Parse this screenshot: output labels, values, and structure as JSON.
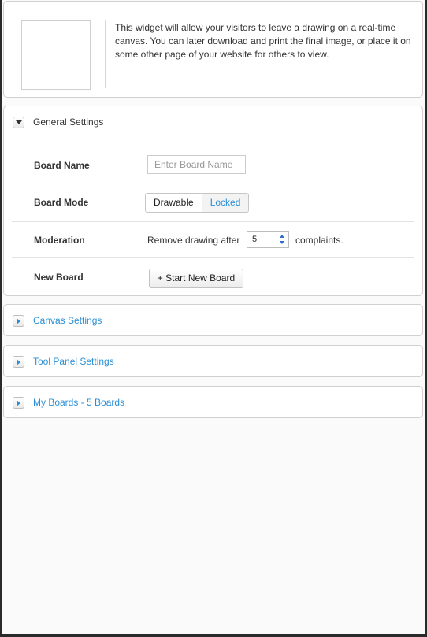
{
  "intro": {
    "description": "This widget will allow your visitors to leave a drawing on a real-time canvas. You can later download and print the final image, or place it on some other page of your website for others to view."
  },
  "general": {
    "title": "General Settings",
    "board_name_label": "Board Name",
    "board_name_placeholder": "Enter Board Name",
    "board_name_value": "",
    "board_mode_label": "Board Mode",
    "mode_drawable": "Drawable",
    "mode_locked": "Locked",
    "mode_selected": "Drawable",
    "moderation_label": "Moderation",
    "moderation_prefix": "Remove drawing after",
    "moderation_value": "5",
    "moderation_suffix": "complaints.",
    "new_board_label": "New Board",
    "new_board_button": "+ Start New Board"
  },
  "sections": {
    "canvas": "Canvas Settings",
    "tool_panel": "Tool Panel Settings",
    "my_boards": "My Boards - 5 Boards"
  },
  "colors": {
    "link": "#2b8fd6",
    "background": "#fafafa",
    "border": "#d0d0d0"
  }
}
